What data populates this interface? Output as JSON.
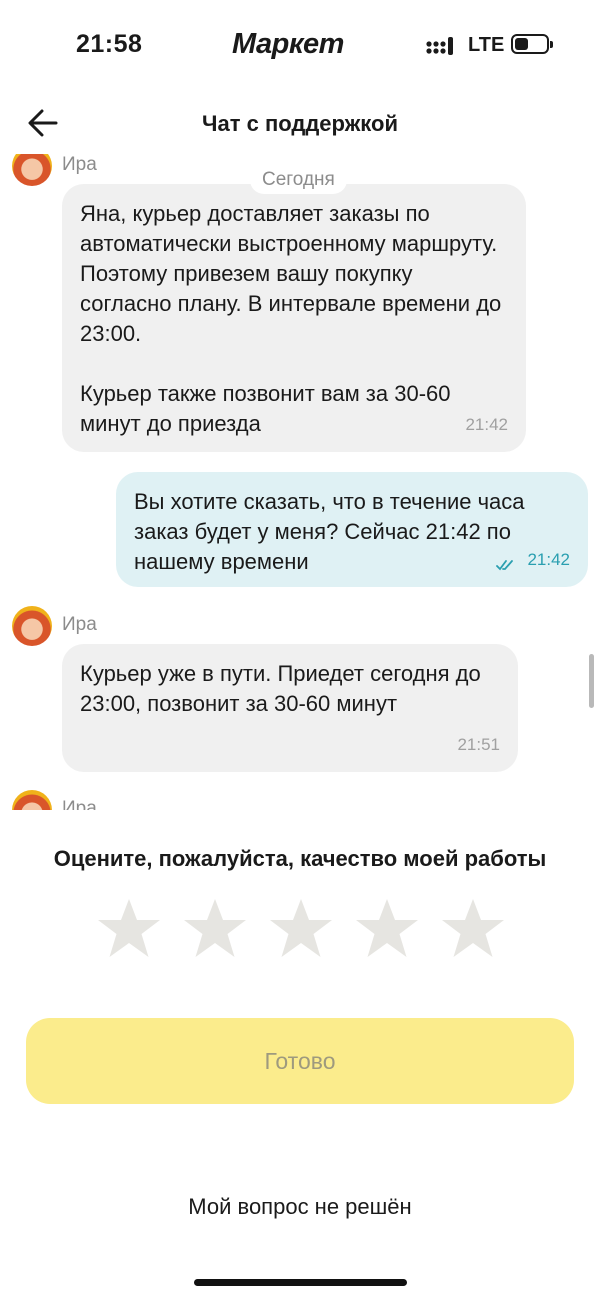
{
  "status_bar": {
    "time": "21:58",
    "app_logo": "Маркет",
    "network": "LTE",
    "icons": [
      "signal-icon",
      "battery-icon"
    ]
  },
  "header": {
    "title": "Чат с поддержкой",
    "back_icon": "back-arrow-icon"
  },
  "chat": {
    "date_separator": "Сегодня",
    "messages": [
      {
        "direction": "incoming",
        "sender": "Ира",
        "text": "Яна, курьер доставляет заказы по автоматически выстроенному маршруту. Поэтому привезем вашу покупку согласно плану. В интервале времени до 23:00.\n\nКурьер также позвонит вам за 30-60 минут до приезда",
        "time": "21:42"
      },
      {
        "direction": "outgoing",
        "text": "Вы хотите сказать, что в течение часа заказ будет у меня? Сейчас 21:42 по нашему времени",
        "time": "21:42",
        "status_icon": "double-check-icon"
      },
      {
        "direction": "incoming",
        "sender": "Ира",
        "text": "Курьер уже в пути. Приедет сегодня до 23:00, позвонит за 30-60 минут",
        "time": "21:51"
      },
      {
        "direction": "incoming",
        "sender": "Ира",
        "text": "",
        "time": ""
      }
    ]
  },
  "rating": {
    "title": "Оцените, пожалуйста, качество моей работы",
    "max": 5,
    "value": 0,
    "star_color": "#e6e5e1"
  },
  "actions": {
    "done_label": "Готово",
    "unsolved_label": "Мой вопрос не решён"
  },
  "colors": {
    "incoming_bubble": "#f0f0f0",
    "outgoing_bubble": "#dff1f4",
    "done_button": "#fbec8c",
    "accent_time": "#2a9fb0"
  }
}
